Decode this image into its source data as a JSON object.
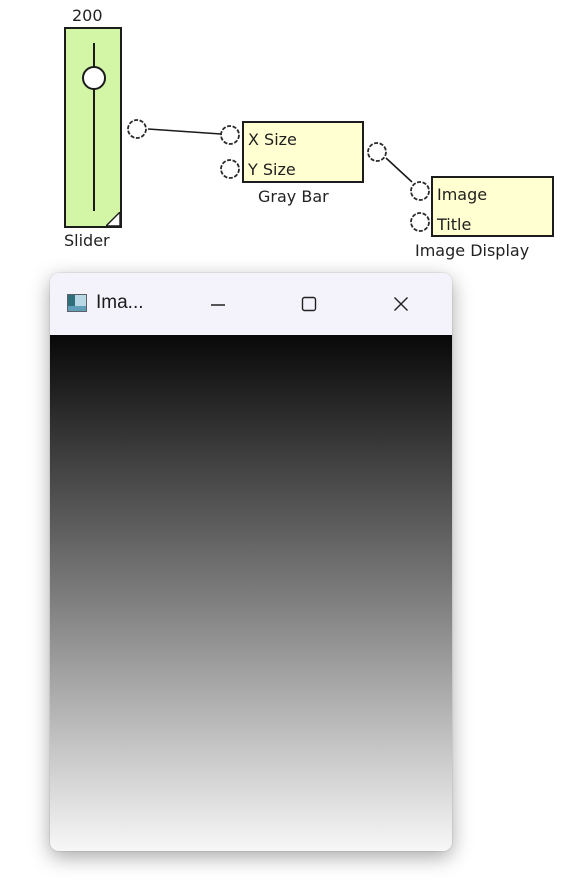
{
  "diagram": {
    "slider": {
      "value": "200",
      "caption": "Slider",
      "fill_color": "#d2f6a5",
      "knob_icon": "circle-knob-icon",
      "corner_icon": "resize-corner-icon"
    },
    "gray_bar": {
      "caption": "Gray Bar",
      "fill_color": "#ffffd2",
      "inputs": [
        "X Size",
        "Y Size"
      ],
      "port_icon": "circle-port-icon"
    },
    "image_display": {
      "caption": "Image Display",
      "fill_color": "#ffffd2",
      "inputs": [
        "Image",
        "Title"
      ],
      "port_icon": "circle-port-icon"
    },
    "wire_color": "#1a1a1a"
  },
  "window": {
    "title": "Ima...",
    "app_icon": "image-app-icon",
    "controls": {
      "minimize_icon": "minimize-icon",
      "maximize_icon": "maximize-icon",
      "close_icon": "close-icon"
    },
    "image": {
      "type": "vertical-gray-gradient",
      "top_color": "#080808",
      "middle_color": "#7b7b7b",
      "bottom_color": "#f7f7f7"
    }
  }
}
